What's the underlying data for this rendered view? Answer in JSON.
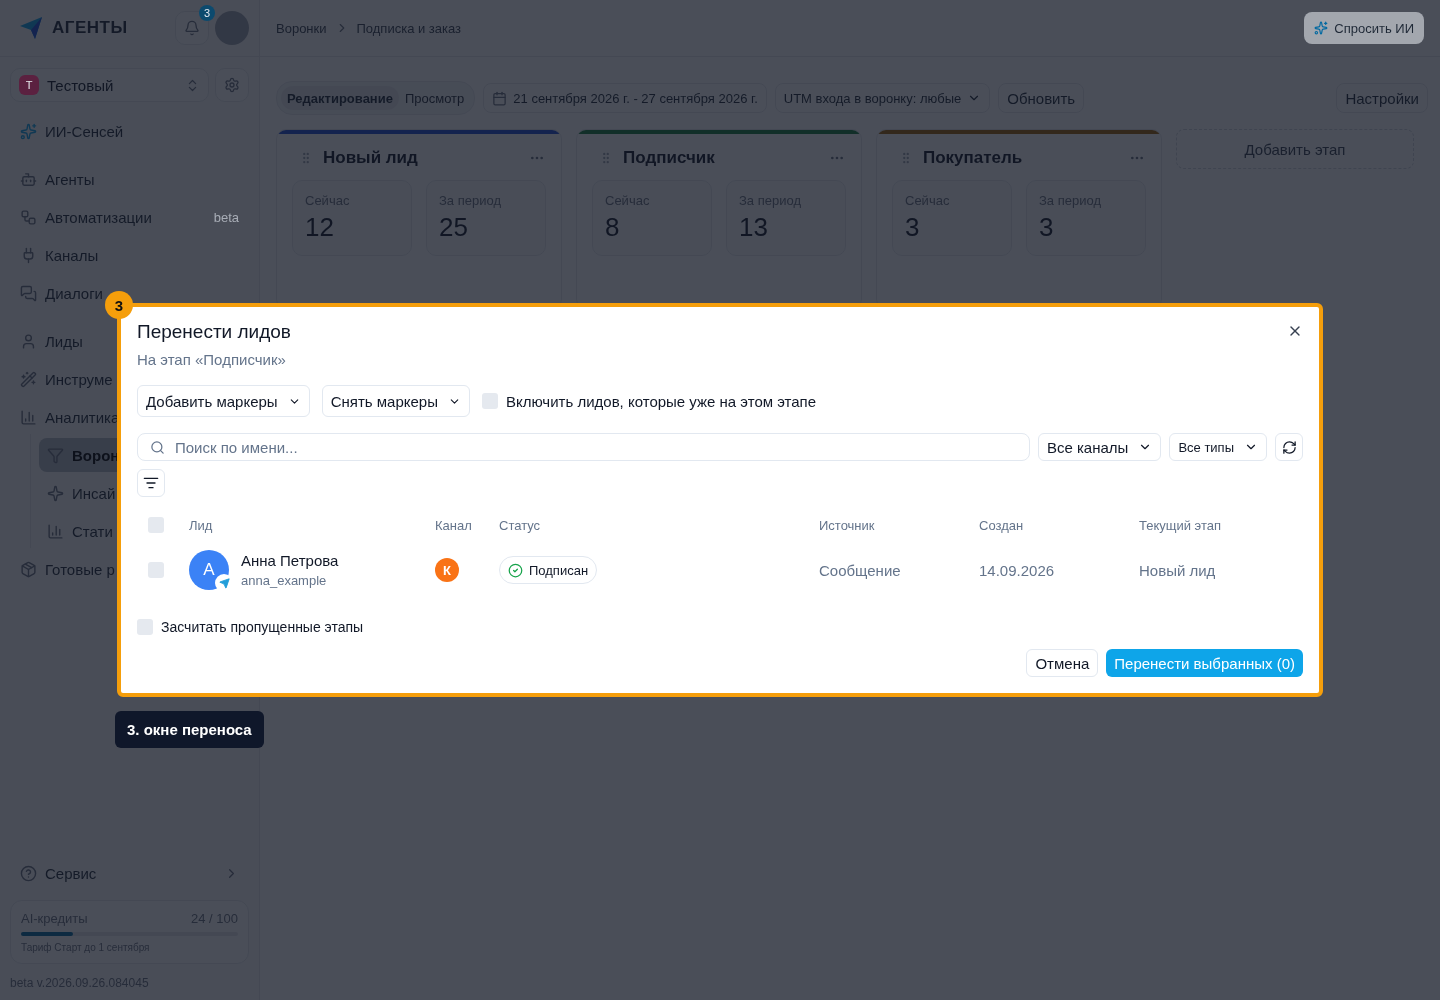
{
  "brand": {
    "name": "АГЕНТЫ"
  },
  "notifications": {
    "count": "3"
  },
  "workspace": {
    "initial": "Т",
    "name": "Тестовый"
  },
  "sidebar": {
    "groups": [
      {
        "items": [
          {
            "label": "ИИ-Сенсей",
            "selected": false
          }
        ]
      },
      {
        "items": [
          {
            "label": "Агенты",
            "selected": false
          },
          {
            "label": "Автоматизации",
            "selected": false,
            "badge": "beta"
          },
          {
            "label": "Каналы",
            "selected": false
          },
          {
            "label": "Диалоги",
            "selected": false
          }
        ]
      },
      {
        "items": [
          {
            "label": "Лиды",
            "selected": false
          },
          {
            "label": "Инструме",
            "selected": false
          },
          {
            "label": "Аналитика",
            "selected": false,
            "children": [
              {
                "label": "Ворон",
                "selected": true
              },
              {
                "label": "Инсай",
                "selected": false
              },
              {
                "label": "Стати",
                "selected": false
              }
            ]
          },
          {
            "label": "Готовые р",
            "selected": false
          }
        ]
      }
    ],
    "service": "Сервис",
    "credits": {
      "label": "AI-кредиты",
      "value": "24 / 100",
      "level": 0.24,
      "plan": "Тариф Старт до 1 сентября"
    },
    "version": "beta v.2026.09.26.084045"
  },
  "header": {
    "breadcrumbs": [
      "Воронки",
      "Подписка и заказ"
    ],
    "ask_ai": "Спросить ИИ"
  },
  "toolbar": {
    "modes": [
      {
        "label": "Редактирование",
        "selected": true
      },
      {
        "label": "Просмотр",
        "selected": false
      }
    ],
    "date_range": "21 сентября 2026 г. - 27 сентября 2026 г.",
    "utm": "UTM входа в воронку: любые",
    "refresh": "Обновить",
    "settings": "Настройки"
  },
  "stages": [
    {
      "title": "Новый лид",
      "color": "#14234e",
      "metrics": [
        {
          "label": "Сейчас",
          "value": "12"
        },
        {
          "label": "За период",
          "value": "25"
        }
      ]
    },
    {
      "title": "Подписчик",
      "color": "#122f29",
      "metrics": [
        {
          "label": "Сейчас",
          "value": "8"
        },
        {
          "label": "За период",
          "value": "13"
        }
      ]
    },
    {
      "title": "Покупатель",
      "color": "#33281c",
      "metrics": [
        {
          "label": "Сейчас",
          "value": "3"
        },
        {
          "label": "За период",
          "value": "3"
        }
      ]
    }
  ],
  "add_stage": "Добавить этап",
  "modal": {
    "step_badge": "3",
    "title": "Перенести лидов",
    "subtitle": "На этап «Подписчик»",
    "add_markers": "Добавить маркеры",
    "remove_markers": "Снять маркеры",
    "include_existing": {
      "label": "Включить лидов, которые уже на этом этапе",
      "checked": false
    },
    "search": {
      "placeholder": "Поиск по имени..."
    },
    "channel_filter": "Все каналы",
    "type_filter": "Все типы",
    "select_all": {
      "checked": false
    },
    "columns": [
      "Лид",
      "Канал",
      "Статус",
      "Источник",
      "Создан",
      "Текущий этап"
    ],
    "rows": [
      {
        "checked": false,
        "avatar": "A",
        "name": "Анна Петрова",
        "username": "anna_example",
        "channel": "К",
        "status": "Подписан",
        "source": "Сообщение",
        "created": "14.09.2026",
        "stage": "Новый лид"
      }
    ],
    "count_skipped": {
      "label": "Засчитать пропущенные этапы",
      "checked": false
    },
    "cancel": "Отмена",
    "submit": "Перенести выбранных (0)"
  },
  "tooltip": "3. окне переноса"
}
